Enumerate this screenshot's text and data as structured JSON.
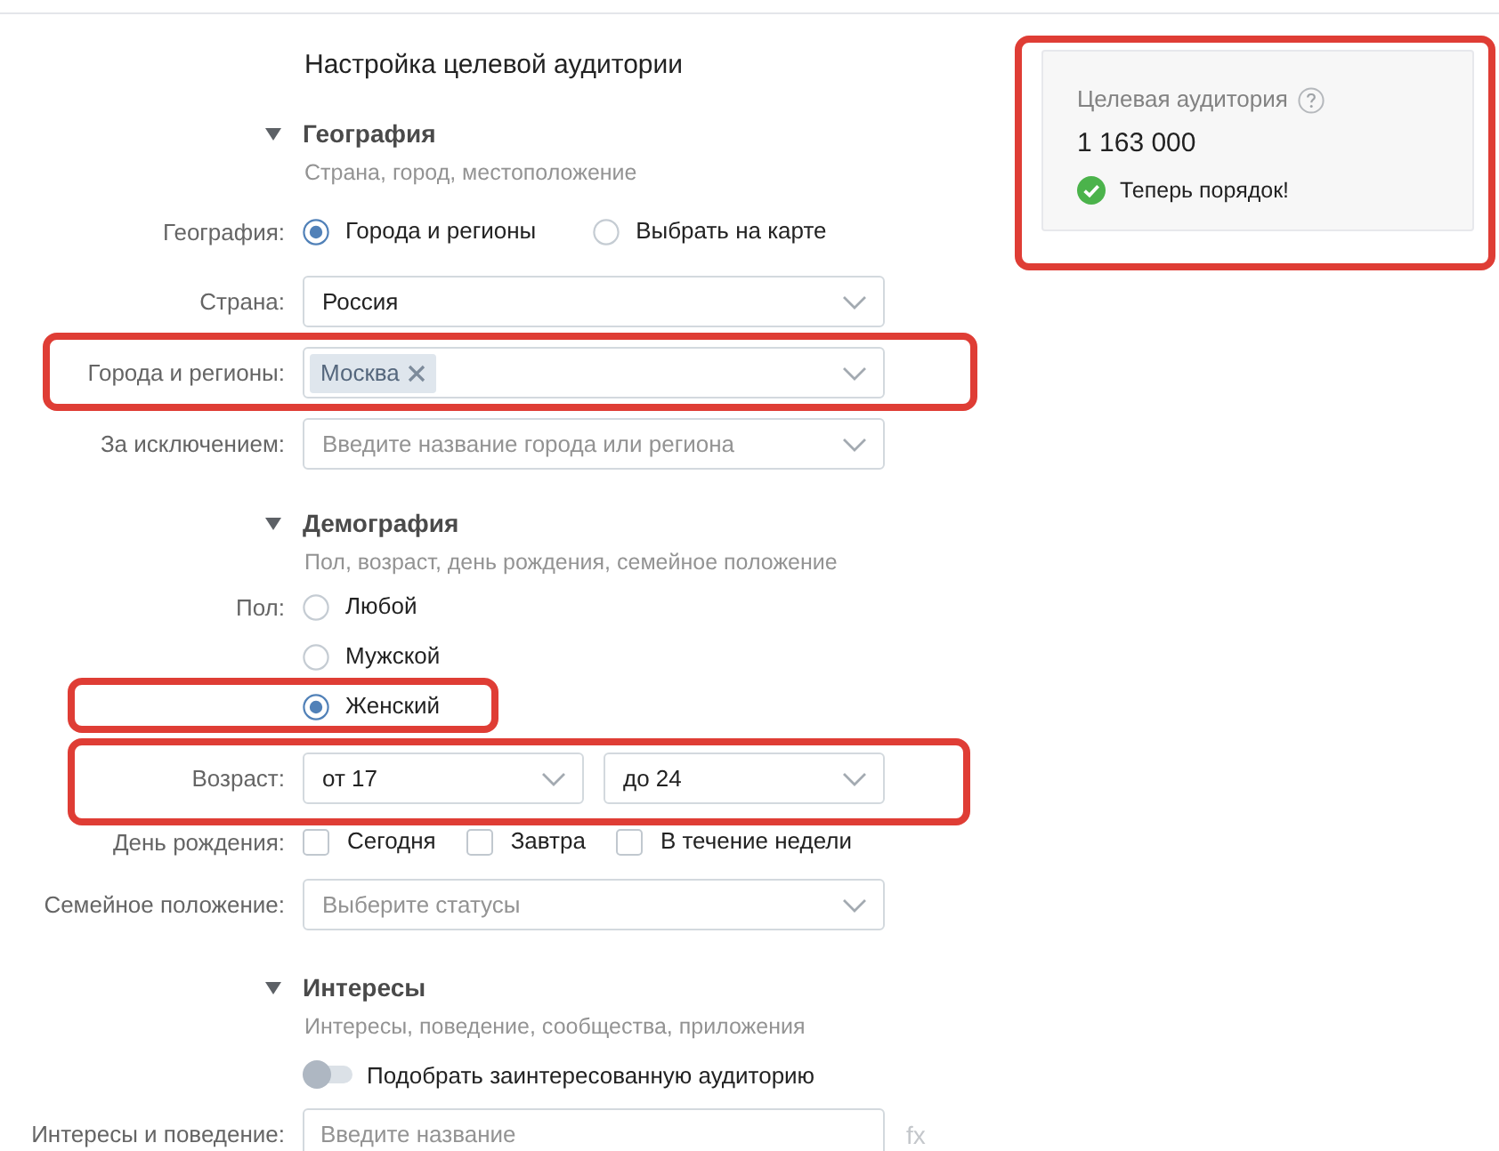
{
  "title": "Настройка целевой аудитории",
  "sections": [
    {
      "title": "География",
      "subtitle": "Страна, город, местоположение",
      "expanded": true,
      "rows": [
        {
          "kind": "radio_inline",
          "label": "География:",
          "highlighted": false,
          "options": [
            {
              "label": "Города и регионы",
              "selected": true,
              "highlighted": false
            },
            {
              "label": "Выбрать на карте",
              "selected": false,
              "highlighted": false
            }
          ]
        },
        {
          "kind": "select",
          "label": "Страна:",
          "value": "Россия",
          "highlighted": false
        },
        {
          "kind": "tags",
          "label": "Города и регионы:",
          "tags": [
            "Москва"
          ],
          "highlighted": true
        },
        {
          "kind": "select",
          "label": "За исключением:",
          "placeholder": "Введите название города или региона",
          "highlighted": false
        }
      ]
    },
    {
      "title": "Демография",
      "subtitle": "Пол, возраст, день рождения, семейное положение",
      "expanded": true,
      "rows": [
        {
          "kind": "radio_stacked",
          "label": "Пол:",
          "highlighted": false,
          "options": [
            {
              "label": "Любой",
              "selected": false,
              "highlighted": false
            },
            {
              "label": "Мужской",
              "selected": false,
              "highlighted": false
            },
            {
              "label": "Женский",
              "selected": true,
              "highlighted": true
            }
          ]
        },
        {
          "kind": "range",
          "label": "Возраст:",
          "from": "от 17",
          "to": "до 24",
          "highlighted": true
        },
        {
          "kind": "checkboxes",
          "label": "День рождения:",
          "highlighted": false,
          "options": [
            {
              "label": "Сегодня",
              "checked": false
            },
            {
              "label": "Завтра",
              "checked": false
            },
            {
              "label": "В течение недели",
              "checked": false
            }
          ]
        },
        {
          "kind": "select",
          "label": "Семейное положение:",
          "placeholder": "Выберите статусы",
          "highlighted": false
        }
      ]
    },
    {
      "title": "Интересы",
      "subtitle": "Интересы, поведение, сообщества, приложения",
      "expanded": true,
      "rows": [
        {
          "kind": "toggle",
          "text": "Подобрать заинтересованную аудиторию",
          "on": false,
          "highlighted": false
        },
        {
          "kind": "input",
          "label": "Интересы и поведение:",
          "placeholder": "Введите название",
          "action": "fx",
          "highlighted": false
        }
      ]
    }
  ],
  "audience": {
    "label": "Целевая аудитория",
    "count": "1 163 000",
    "status": "Теперь порядок!",
    "highlighted": true
  }
}
